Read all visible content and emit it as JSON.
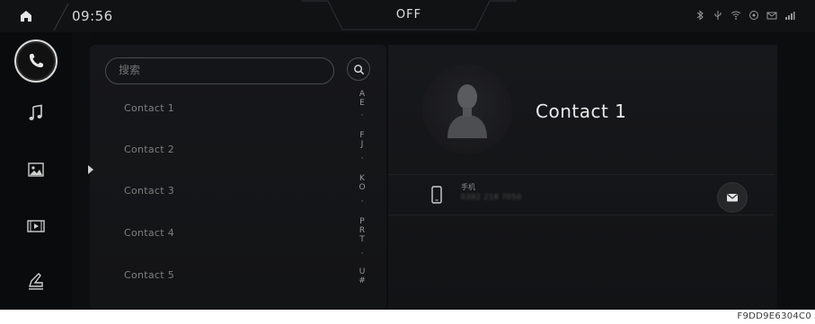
{
  "status_bar": {
    "time": "09:56",
    "ac_state": "OFF",
    "icons": [
      "bluetooth-icon",
      "usb-icon",
      "wifi-icon",
      "hotspot-icon",
      "message-icon",
      "signal-icon"
    ]
  },
  "rail": {
    "items": [
      {
        "name": "phone",
        "icon": "phone-icon",
        "active": true
      },
      {
        "name": "music",
        "icon": "music-note-icon",
        "active": false
      },
      {
        "name": "gallery",
        "icon": "image-icon",
        "active": false
      },
      {
        "name": "video",
        "icon": "video-icon",
        "active": false
      },
      {
        "name": "cleaning",
        "icon": "car-wash-icon",
        "active": false
      }
    ]
  },
  "search": {
    "placeholder": "搜索"
  },
  "contacts": [
    {
      "name": "Contact 1"
    },
    {
      "name": "Contact 2"
    },
    {
      "name": "Contact 3"
    },
    {
      "name": "Contact 4"
    },
    {
      "name": "Contact 5"
    }
  ],
  "alpha_index": [
    "A",
    "E",
    "·",
    "F",
    "J",
    "·",
    "K",
    "O",
    "·",
    "P",
    "R",
    "T",
    "·",
    "U",
    "#"
  ],
  "detail": {
    "name": "Contact 1",
    "phone_label": "手机",
    "phone_number": "0392 218 7050"
  },
  "caption": "F9DD9E6304C0",
  "colors": {
    "background": "#0c0d0f",
    "panel": "#16171a",
    "text_primary": "#eaeaea",
    "text_muted": "#7e7e7e",
    "accent_outline": "#d9d9d9"
  }
}
